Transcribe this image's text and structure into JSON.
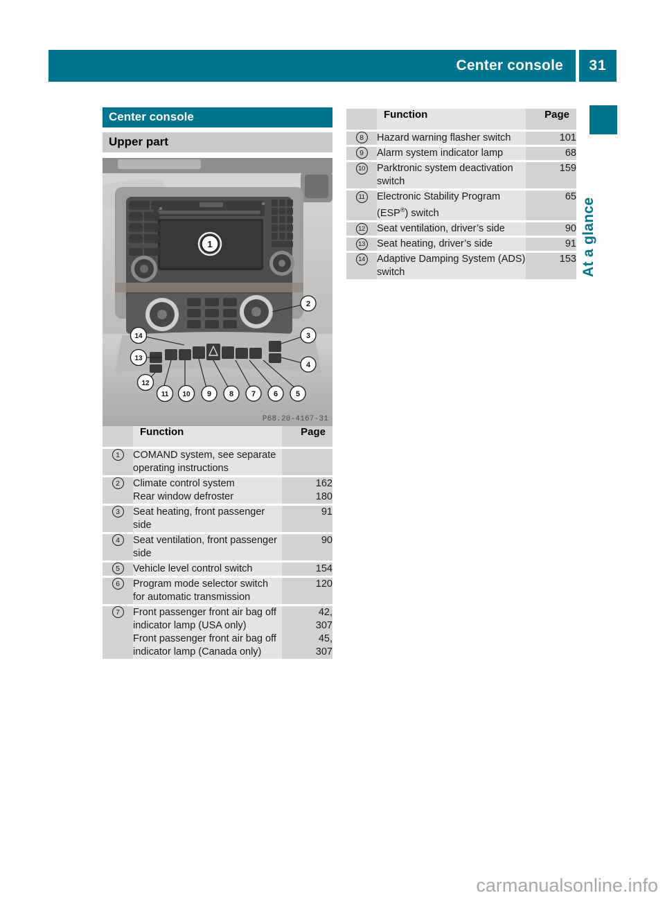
{
  "header": {
    "title": "Center console",
    "page_number": "31"
  },
  "side": {
    "tab_label": "At a glance",
    "accent_color": "#00748c"
  },
  "left_column": {
    "section_title": "Center console",
    "subsection_title": "Upper part",
    "figure": {
      "caption": "P68.20-4167-31",
      "callouts": [
        "1",
        "2",
        "3",
        "4",
        "5",
        "6",
        "7",
        "8",
        "9",
        "10",
        "11",
        "12",
        "13",
        "14"
      ]
    },
    "table": {
      "headers": {
        "num": "",
        "function": "Function",
        "page": "Page"
      },
      "rows": [
        {
          "num": "1",
          "function": "COMAND system, see separate operating instructions",
          "page": ""
        },
        {
          "num": "2",
          "function": "Climate control system",
          "page": "162"
        },
        {
          "num": "",
          "function": "Rear window defroster",
          "page": "180",
          "continuation": true
        },
        {
          "num": "3",
          "function": "Seat heating, front passenger side",
          "page": "91"
        },
        {
          "num": "4",
          "function": "Seat ventilation, front passenger side",
          "page": "90"
        },
        {
          "num": "5",
          "function": "Vehicle level control switch",
          "page": "154"
        },
        {
          "num": "6",
          "function": "Program mode selector switch for automatic transmission",
          "page": "120"
        },
        {
          "num": "7",
          "function": "Front passenger front air bag off indicator lamp (USA only)",
          "page": "42, 307"
        },
        {
          "num": "",
          "function": "Front passenger front air bag off indicator lamp (Canada only)",
          "page": "45, 307",
          "continuation": true
        }
      ]
    }
  },
  "right_column": {
    "table": {
      "headers": {
        "num": "",
        "function": "Function",
        "page": "Page"
      },
      "rows": [
        {
          "num": "8",
          "function": "Hazard warning flasher switch",
          "page": "101"
        },
        {
          "num": "9",
          "function": "Alarm system indicator lamp",
          "page": "68"
        },
        {
          "num": "10",
          "function": "Parktronic system deactivation switch",
          "page": "159"
        },
        {
          "num": "11",
          "function": "Electronic Stability Program (ESP®) switch",
          "page": "65"
        },
        {
          "num": "12",
          "function": "Seat ventilation, driver’s side",
          "page": "90"
        },
        {
          "num": "13",
          "function": "Seat heating, driver’s side",
          "page": "91"
        },
        {
          "num": "14",
          "function": "Adaptive Damping System (ADS) switch",
          "page": "153"
        }
      ]
    }
  },
  "watermark": "carmanualsonline.info"
}
